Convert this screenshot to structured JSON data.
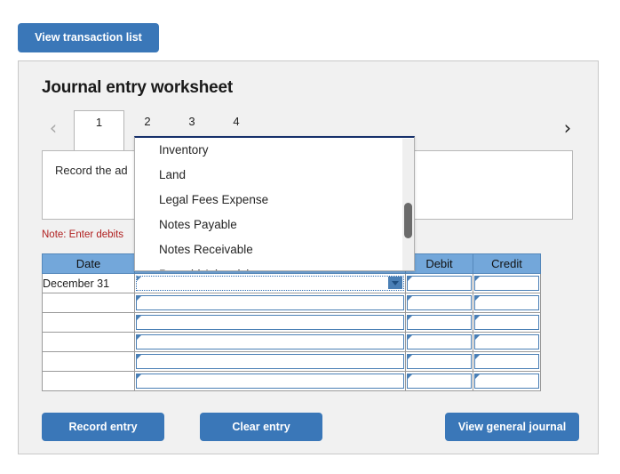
{
  "toolbar": {
    "view_transaction_list_label": "View transaction list"
  },
  "worksheet": {
    "title": "Journal entry worksheet",
    "nav": {
      "prev_icon": "‹",
      "next_icon": "›"
    },
    "tabs": [
      {
        "label": "1",
        "active": true
      },
      {
        "label": "2",
        "active": false
      },
      {
        "label": "3",
        "active": false
      },
      {
        "label": "4",
        "active": false
      }
    ],
    "description": "Record the ad",
    "note": "Note: Enter debits"
  },
  "table": {
    "headers": [
      "Date",
      "",
      "Debit",
      "Credit"
    ],
    "rows": [
      {
        "date": "December 31",
        "account": "",
        "debit": "",
        "credit": "",
        "selected": true
      },
      {
        "date": "",
        "account": "",
        "debit": "",
        "credit": "",
        "selected": false
      },
      {
        "date": "",
        "account": "",
        "debit": "",
        "credit": "",
        "selected": false
      },
      {
        "date": "",
        "account": "",
        "debit": "",
        "credit": "",
        "selected": false
      },
      {
        "date": "",
        "account": "",
        "debit": "",
        "credit": "",
        "selected": false
      },
      {
        "date": "",
        "account": "",
        "debit": "",
        "credit": "",
        "selected": false
      }
    ]
  },
  "dropdown": {
    "open": true,
    "options": [
      "Inventory",
      "Land",
      "Legal Fees Expense",
      "Notes Payable",
      "Notes Receivable",
      "Prepaid Advertising"
    ],
    "scroll_position_pct": 48
  },
  "actions": {
    "record_entry_label": "Record entry",
    "clear_entry_label": "Clear entry",
    "view_general_journal_label": "View general journal"
  },
  "colors": {
    "accent_blue": "#3a77b8",
    "table_header_blue": "#73a7da",
    "cell_border_blue": "#4a7fb5",
    "note_red": "#b02020",
    "panel_gray": "#f1f1f1",
    "dropdown_top_border": "#16306b"
  }
}
